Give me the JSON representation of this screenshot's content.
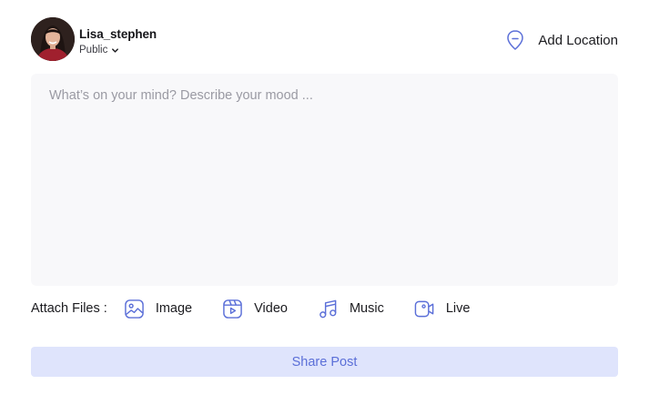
{
  "user": {
    "name": "Lisa_stephen",
    "privacy": "Public"
  },
  "location": {
    "label": "Add Location"
  },
  "composer": {
    "placeholder": "What’s on your mind? Describe your mood ...",
    "value": ""
  },
  "attach": {
    "label": "Attach Files :",
    "items": [
      {
        "label": "Image",
        "icon": "image-icon"
      },
      {
        "label": "Video",
        "icon": "reel-video-icon"
      },
      {
        "label": "Music",
        "icon": "music-note-icon"
      },
      {
        "label": "Live",
        "icon": "live-camera-icon"
      }
    ]
  },
  "share": {
    "label": "Share Post"
  },
  "colors": {
    "accent": "#5b6fd8",
    "button_bg": "#dfe4fc",
    "composer_bg": "#f8f8fa"
  }
}
